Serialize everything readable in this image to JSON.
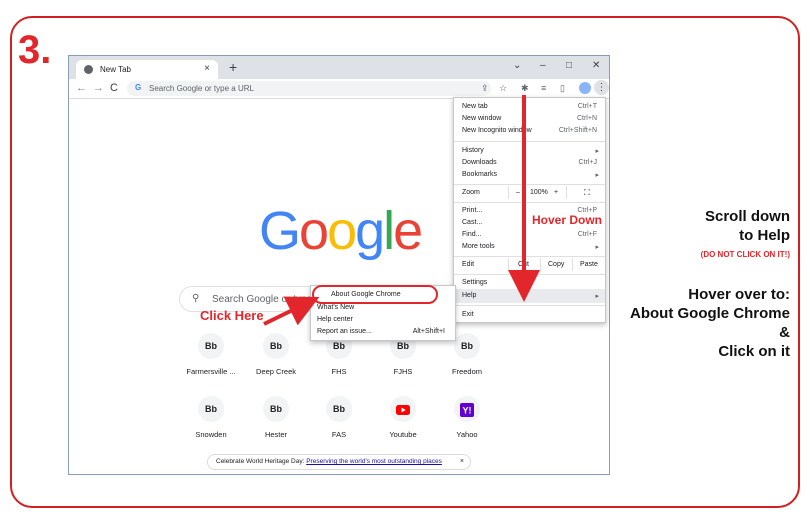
{
  "step_number": "3.",
  "browser": {
    "tab_title": "New Tab",
    "tab_close": "×",
    "new_tab": "+",
    "window_controls": [
      "⌄",
      "–",
      "□",
      "✕"
    ],
    "nav": [
      "←",
      "→",
      "C"
    ],
    "omnibox_g": "G",
    "omnibox_placeholder": "Search Google or type a URL",
    "toolbar_icons": [
      "⇪",
      "☆",
      "✱",
      "≡",
      "▯"
    ],
    "kebab": "⋮"
  },
  "page": {
    "logo_letters": [
      {
        "char": "G",
        "color": "#4285f4"
      },
      {
        "char": "o",
        "color": "#ea4335"
      },
      {
        "char": "o",
        "color": "#fbbc05"
      },
      {
        "char": "g",
        "color": "#4285f4"
      },
      {
        "char": "l",
        "color": "#34a853"
      },
      {
        "char": "e",
        "color": "#ea4335"
      }
    ],
    "search_placeholder": "Search Google or type a",
    "shortcuts_row1": [
      {
        "label": "Farmersville ...",
        "icon": "Bb"
      },
      {
        "label": "Deep Creek",
        "icon": "Bb"
      },
      {
        "label": "FHS",
        "icon": "Bb"
      },
      {
        "label": "FJHS",
        "icon": "Bb"
      },
      {
        "label": "Freedom",
        "icon": "Bb"
      }
    ],
    "shortcuts_row2": [
      {
        "label": "Snowden",
        "icon": "Bb"
      },
      {
        "label": "Hester",
        "icon": "Bb"
      },
      {
        "label": "FAS",
        "icon": "Bb"
      },
      {
        "label": "Youtube",
        "icon": "youtube-icon"
      },
      {
        "label": "Yahoo",
        "icon": "yahoo-icon"
      }
    ],
    "heritage_prefix": "Celebrate World Heritage Day:",
    "heritage_link": "Preserving the world's most outstanding places",
    "heritage_close": "×"
  },
  "menu": {
    "new_tab": "New tab",
    "new_tab_sc": "Ctrl+T",
    "new_window": "New window",
    "new_window_sc": "Ctrl+N",
    "incognito": "New Incognito window",
    "incognito_sc": "Ctrl+Shift+N",
    "history": "History",
    "downloads": "Downloads",
    "downloads_sc": "Ctrl+J",
    "bookmarks": "Bookmarks",
    "zoom": "Zoom",
    "zoom_minus": "–",
    "zoom_value": "100%",
    "zoom_plus": "+",
    "print": "Print...",
    "print_sc": "Ctrl+P",
    "cast": "Cast...",
    "find": "Find...",
    "find_sc": "Ctrl+F",
    "more_tools": "More tools",
    "edit": "Edit",
    "cut": "Cut",
    "copy": "Copy",
    "paste": "Paste",
    "settings": "Settings",
    "help": "Help",
    "exit": "Exit",
    "arrow": "▸"
  },
  "submenu": {
    "about": "About Google Chrome",
    "whats_new": "What's New",
    "help_center": "Help center",
    "report": "Report an issue...",
    "report_sc": "Alt+Shift+I"
  },
  "annotations": {
    "hover_down": "Hover Down",
    "click_here": "Click Here",
    "instr1_line1": "Scroll down",
    "instr1_line2": "to Help",
    "instr_warn": "(DO NOT CLICK ON IT!)",
    "instr2_line1": "Hover over to:",
    "instr2_line2": "About Google Chrome",
    "instr2_line3": "&",
    "instr2_line4": "Click on it"
  },
  "colors": {
    "annotation_red": "#e3262c",
    "frame_red": "#d21f1f"
  }
}
